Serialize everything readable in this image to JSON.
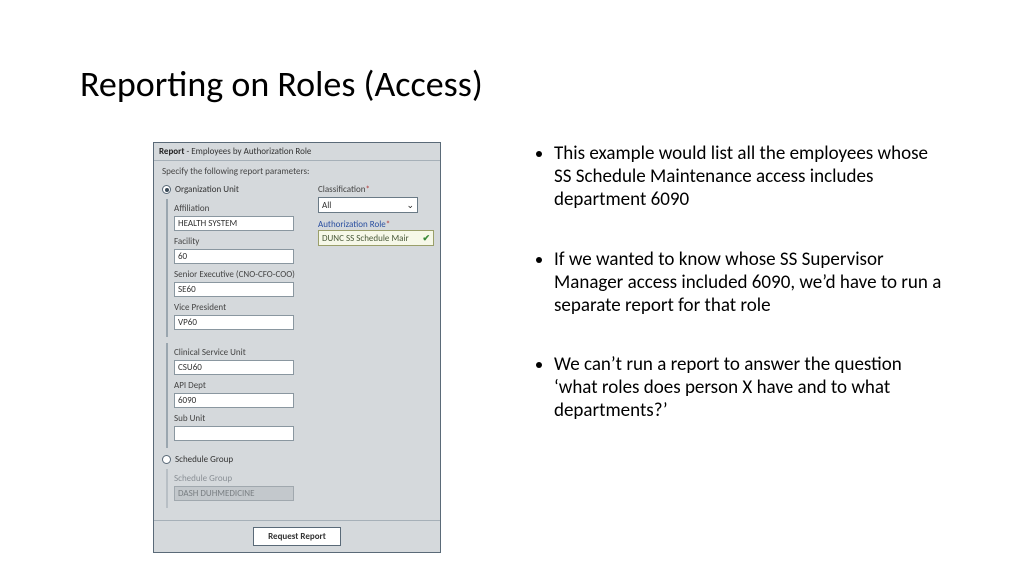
{
  "slide": {
    "title": "Reporting on Roles (Access)"
  },
  "panel": {
    "header_bold": "Report",
    "header_rest": " - Employees by Authorization Role",
    "subtitle": "Specify the following report parameters:",
    "radio_org_unit": "Organization Unit",
    "radio_schedule_group": "Schedule Group",
    "classification_label": "Classification",
    "classification_value": "All",
    "auth_role_label": "Authorization Role",
    "auth_role_value": "DUNC SS Schedule Mair",
    "fields": {
      "affiliation": {
        "label": "Affiliation",
        "value": "HEALTH SYSTEM"
      },
      "facility": {
        "label": "Facility",
        "value": "60"
      },
      "senior_exec": {
        "label": "Senior Executive (CNO-CFO-COO)",
        "value": "SE60"
      },
      "vice_president": {
        "label": "Vice President",
        "value": "VP60"
      },
      "csu": {
        "label": "Clinical Service Unit",
        "value": "CSU60"
      },
      "api_dept": {
        "label": "API Dept",
        "value": "6090"
      },
      "sub_unit": {
        "label": "Sub Unit",
        "value": ""
      },
      "schedule_group": {
        "label": "Schedule Group",
        "value": "DASH DUHMEDICINE"
      }
    },
    "request_button": "Request Report"
  },
  "bullets": {
    "b1": "This example would list all the employees whose SS Schedule Maintenance access includes department 6090",
    "b2": "If we wanted to know whose SS Supervisor Manager access included 6090, we’d have to run a separate report for that role",
    "b3": "We can’t run a report to answer the question ‘what roles does person X have and to what departments?’"
  }
}
